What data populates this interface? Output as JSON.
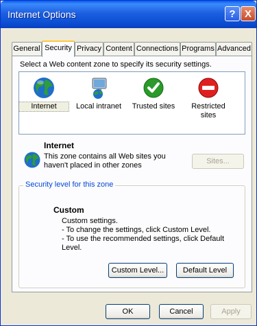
{
  "window": {
    "title": "Internet Options",
    "help_glyph": "?",
    "close_glyph": "X"
  },
  "tabs": [
    {
      "label": "General",
      "active": false
    },
    {
      "label": "Security",
      "active": true
    },
    {
      "label": "Privacy",
      "active": false
    },
    {
      "label": "Content",
      "active": false
    },
    {
      "label": "Connections",
      "active": false
    },
    {
      "label": "Programs",
      "active": false
    },
    {
      "label": "Advanced",
      "active": false
    }
  ],
  "security": {
    "instruction": "Select a Web content zone to specify its security settings.",
    "zones": [
      {
        "label": "Internet",
        "icon": "globe-icon",
        "selected": true
      },
      {
        "label": "Local intranet",
        "icon": "monitor-globe-icon",
        "selected": false
      },
      {
        "label": "Trusted sites",
        "icon": "checkmark-icon",
        "selected": false
      },
      {
        "label": "Restricted sites",
        "icon": "no-entry-icon",
        "selected": false
      }
    ],
    "zone_info": {
      "title": "Internet",
      "line1": "This zone contains all Web sites you",
      "line2": "haven't placed in other zones",
      "sites_button": "Sites..."
    },
    "level_group": {
      "legend": "Security level for this zone",
      "level_name": "Custom",
      "desc_line1": "Custom settings.",
      "desc_line2": "- To change the settings, click Custom Level.",
      "desc_line3": "- To use the recommended settings, click Default Level.",
      "custom_level_button": "Custom Level...",
      "default_level_button": "Default Level"
    }
  },
  "footer": {
    "ok": "OK",
    "cancel": "Cancel",
    "apply": "Apply"
  },
  "colors": {
    "titlebar": "#0a5ce8",
    "window_bg": "#ece9d8",
    "tab_highlight": "#ffc73c",
    "group_legend": "#0046d5"
  }
}
